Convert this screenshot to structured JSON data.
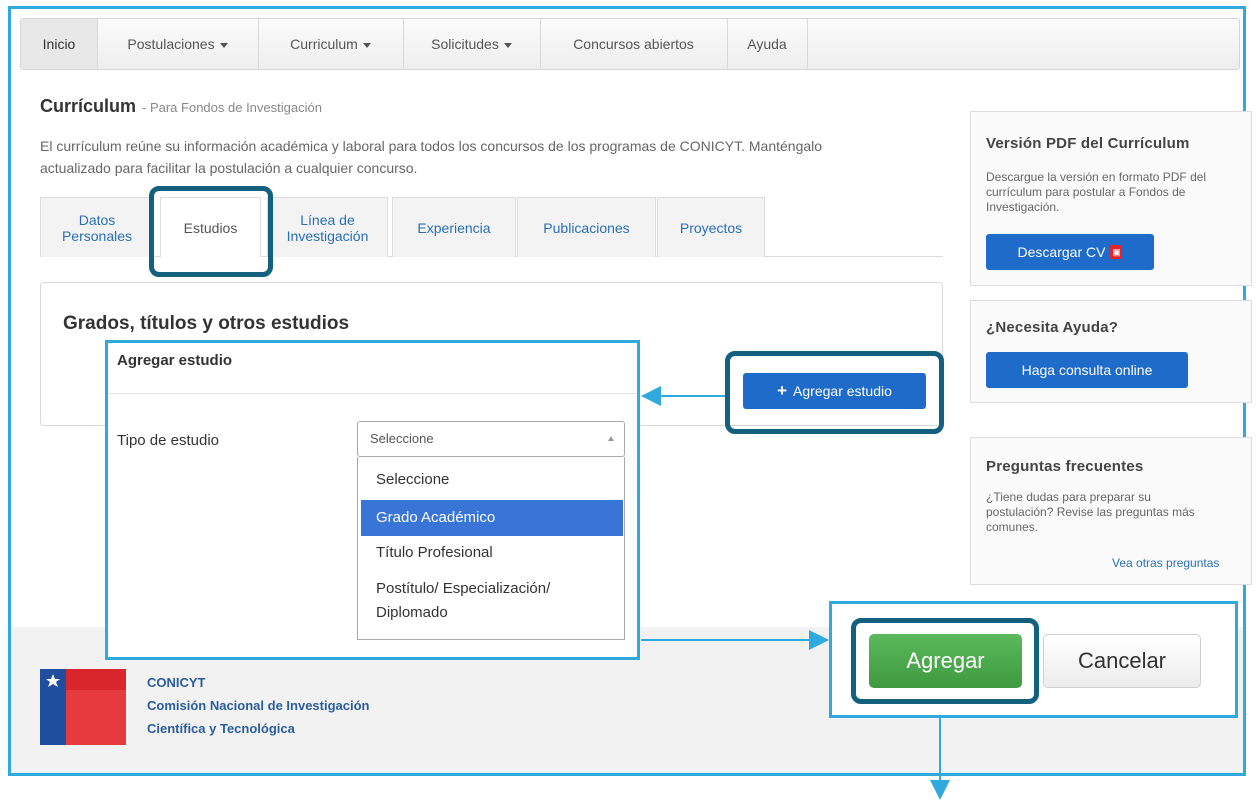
{
  "navbar": {
    "items": [
      {
        "label": "Inicio",
        "dropdown": false
      },
      {
        "label": "Postulaciones",
        "dropdown": true
      },
      {
        "label": "Curriculum",
        "dropdown": true
      },
      {
        "label": "Solicitudes",
        "dropdown": true
      },
      {
        "label": "Concursos abiertos",
        "dropdown": false
      },
      {
        "label": "Ayuda",
        "dropdown": false
      }
    ]
  },
  "page": {
    "title": "Currículum",
    "subtitle": "- Para Fondos de Investigación",
    "intro": "El currículum reúne su información académica y laboral para todos los concursos de los programas de CONICYT. Manténgalo actualizado para facilitar la postulación a cualquier concurso."
  },
  "tabs": [
    {
      "label_line1": "Datos",
      "label_line2": "Personales"
    },
    {
      "label_line1": "Estudios",
      "label_line2": ""
    },
    {
      "label_line1": "Línea de",
      "label_line2": "Investigación"
    },
    {
      "label_line1": "Experiencia",
      "label_line2": ""
    },
    {
      "label_line1": "Publicaciones",
      "label_line2": ""
    },
    {
      "label_line1": "Proyectos",
      "label_line2": ""
    }
  ],
  "active_tab": "Estudios",
  "panel": {
    "title": "Grados, títulos y otros estudios",
    "add_button": "Agregar estudio"
  },
  "modal": {
    "title": "Agregar estudio",
    "field_label": "Tipo de estudio",
    "select_value": "Seleccione",
    "options": [
      {
        "label": "Seleccione"
      },
      {
        "label": "Grado Académico",
        "highlighted": true
      },
      {
        "label": "Título Profesional"
      },
      {
        "label": "Postítulo/ Especialización/",
        "label2": "Diplomado"
      }
    ]
  },
  "sidebar": {
    "pdf": {
      "title": "Versión PDF del Currículum",
      "text": "Descargue la versión en formato PDF del currículum para postular a Fondos de Investigación.",
      "button": "Descargar CV",
      "pdf_icon_glyph": "▣"
    },
    "help": {
      "title": "¿Necesita Ayuda?",
      "button": "Haga consulta online"
    },
    "faq": {
      "title": "Preguntas frecuentes",
      "text": "¿Tiene dudas para preparar su postulación? Revise las preguntas más comunes.",
      "link": "Vea otras preguntas"
    }
  },
  "footer": {
    "org": "CONICYT",
    "line1": "Comisión Nacional de Investigación",
    "line2": "Científica y Tecnológica"
  },
  "actions": {
    "primary": "Agregar",
    "secondary": "Cancelar"
  },
  "colors": {
    "highlight_frame": "#2fa9de",
    "callout": "#13607f",
    "primary_blue": "#1e6bc9",
    "success_green": "#4cae4c",
    "selected_option": "#3875d7"
  }
}
